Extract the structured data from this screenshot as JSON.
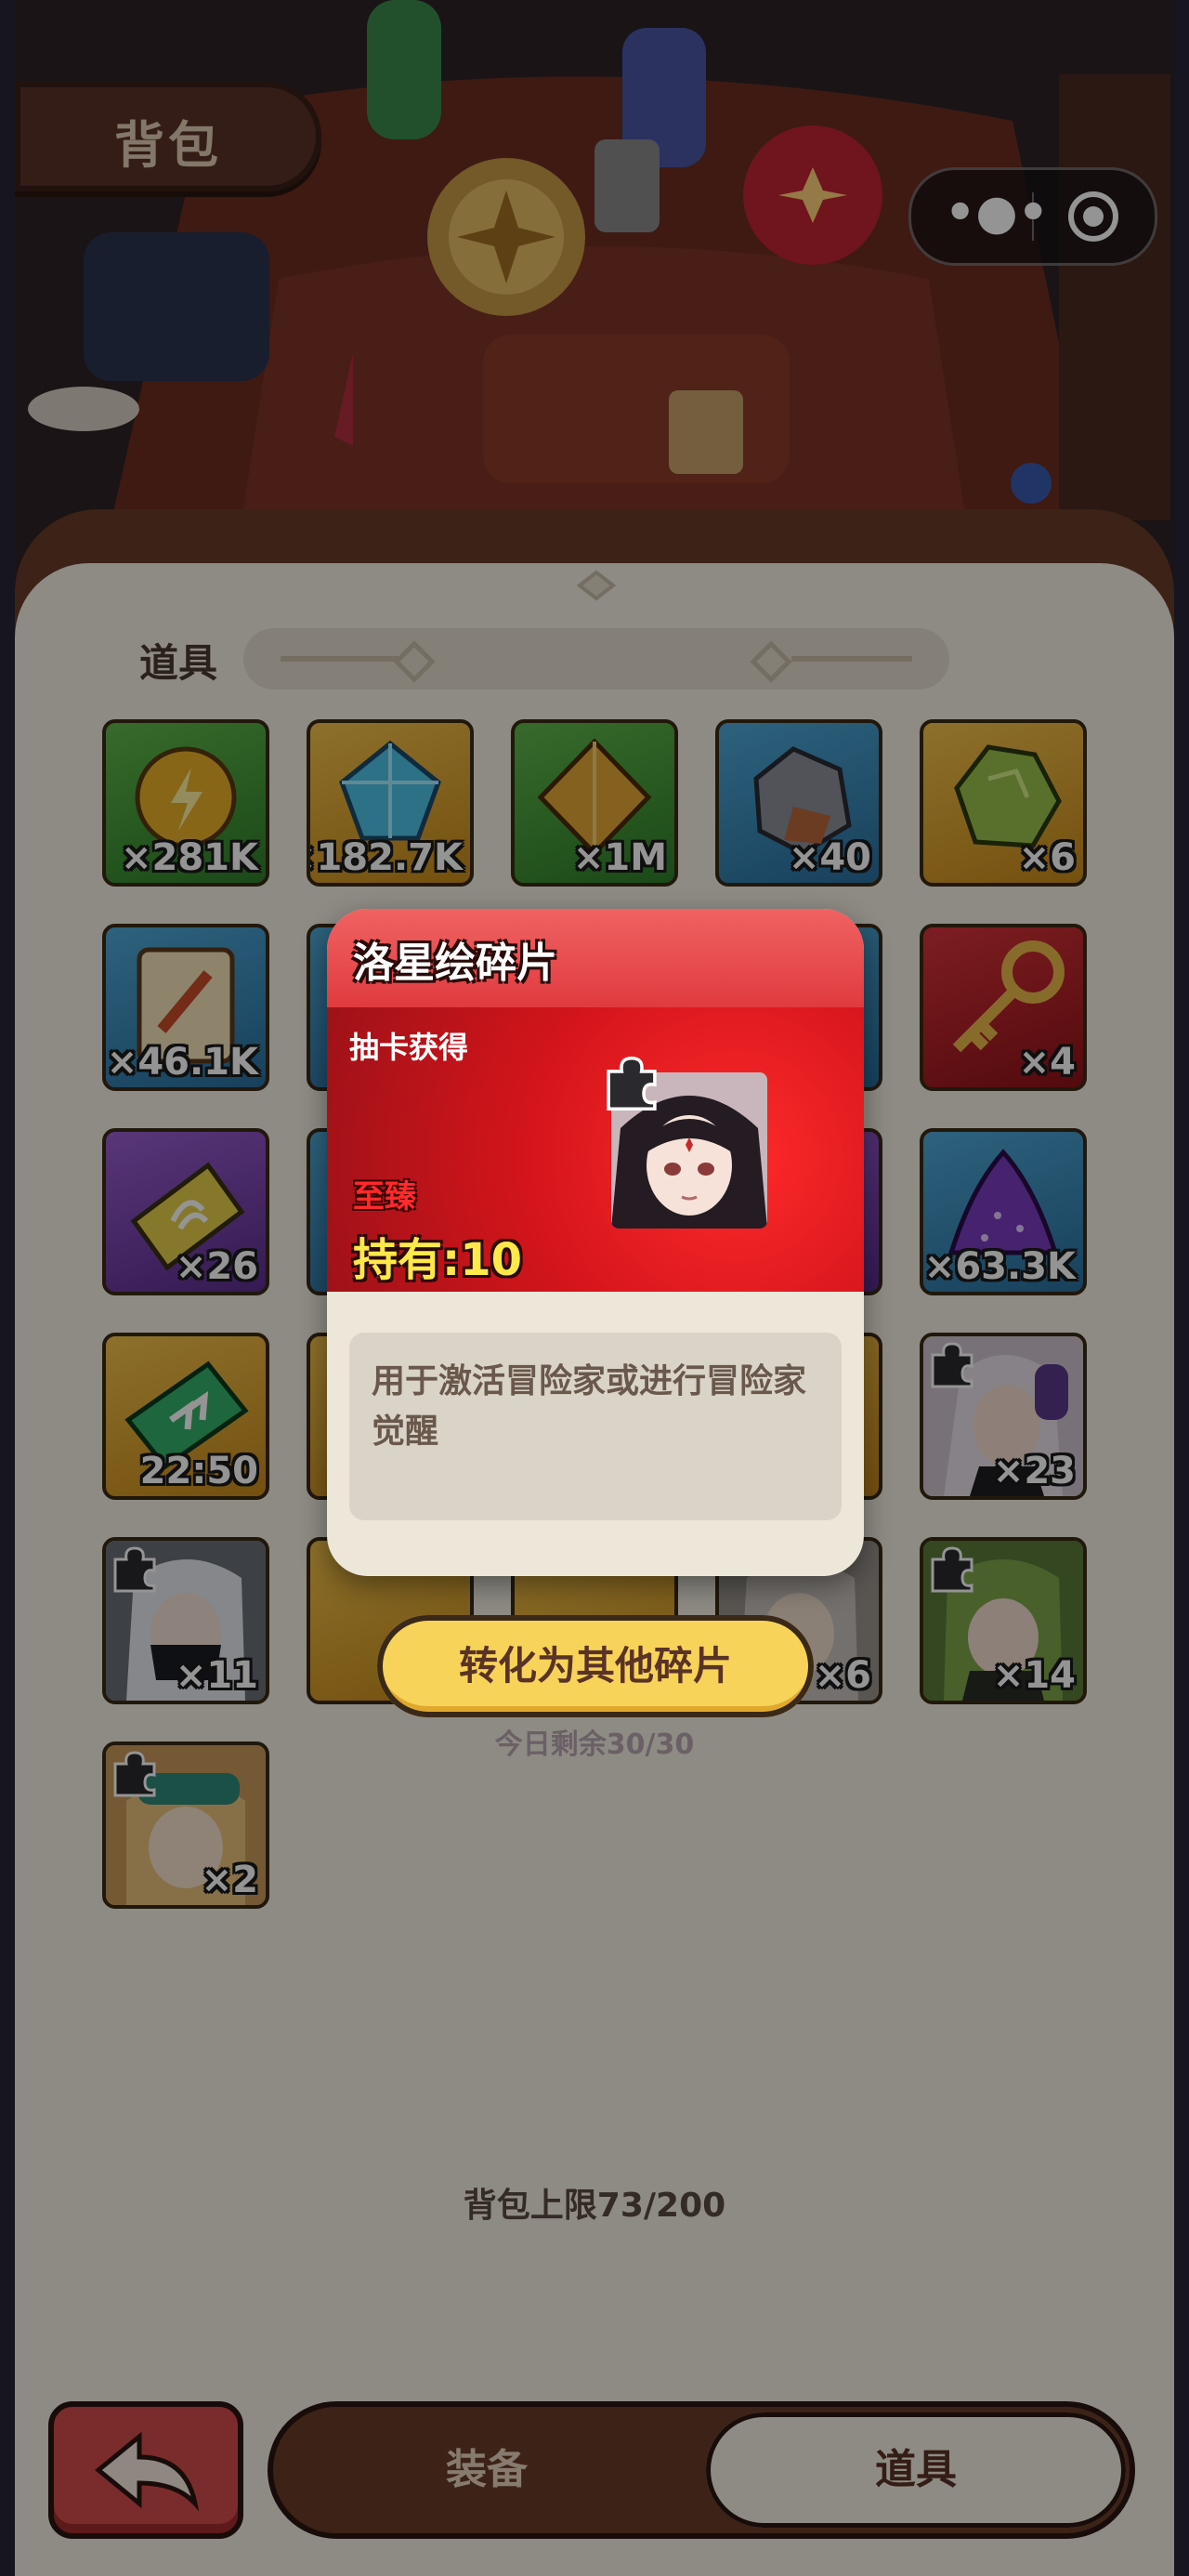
{
  "header": {
    "title": "背包"
  },
  "capsule": {
    "more_icon": "more-icon",
    "close_icon": "target-close-icon"
  },
  "section": {
    "label": "道具"
  },
  "items": [
    {
      "qty": "×281K",
      "bg": "green",
      "icon": "energy-coin-icon"
    },
    {
      "qty": "×182.7K",
      "bg": "gold",
      "icon": "blue-crystal-icon"
    },
    {
      "qty": "×1M",
      "bg": "green",
      "icon": "gold-gem-icon"
    },
    {
      "qty": "×40",
      "bg": "blue",
      "icon": "ore-rock-icon"
    },
    {
      "qty": "×6",
      "bg": "gold",
      "icon": "green-ore-icon"
    },
    {
      "qty": "×46.1K",
      "bg": "blue",
      "icon": "scroll-icon"
    },
    {
      "qty": "×4",
      "bg": "red",
      "icon": "golden-key-icon"
    },
    {
      "qty": "×26",
      "bg": "purple",
      "icon": "ticket-icon"
    },
    {
      "qty": "×63.3K",
      "bg": "blue",
      "icon": "purple-dust-icon"
    },
    {
      "qty": "22:50",
      "bg": "gold",
      "icon": "speed-ticket-icon"
    },
    {
      "qty": "×23",
      "bg": "gold",
      "icon": "hero-fragment-icon"
    },
    {
      "qty": "×11",
      "bg": "gold",
      "icon": "hero-fragment-icon"
    },
    {
      "qty": "×6",
      "bg": "gold",
      "icon": "hero-fragment-icon"
    },
    {
      "qty": "×14",
      "bg": "gold",
      "icon": "hero-fragment-icon"
    },
    {
      "qty": "×2",
      "bg": "gold",
      "icon": "hero-fragment-icon"
    }
  ],
  "capacity": "背包上限73/200",
  "bottom": {
    "back_icon": "back-arrow-icon",
    "tab_equipment": "装备",
    "tab_items": "道具"
  },
  "popup": {
    "title": "洛星绘碎片",
    "source": "抽卡获得",
    "rarity": "至臻",
    "owned": "持有:10",
    "description": "用于激活冒险家或进行冒险家觉醒",
    "button": "转化为其他碎片",
    "remaining": "今日剩余30/30"
  },
  "colors": {
    "accent_red": "#e03b3f",
    "button_yellow": "#f7d35a",
    "panel": "#f4efe4",
    "frame_brown": "#6a3c28"
  }
}
